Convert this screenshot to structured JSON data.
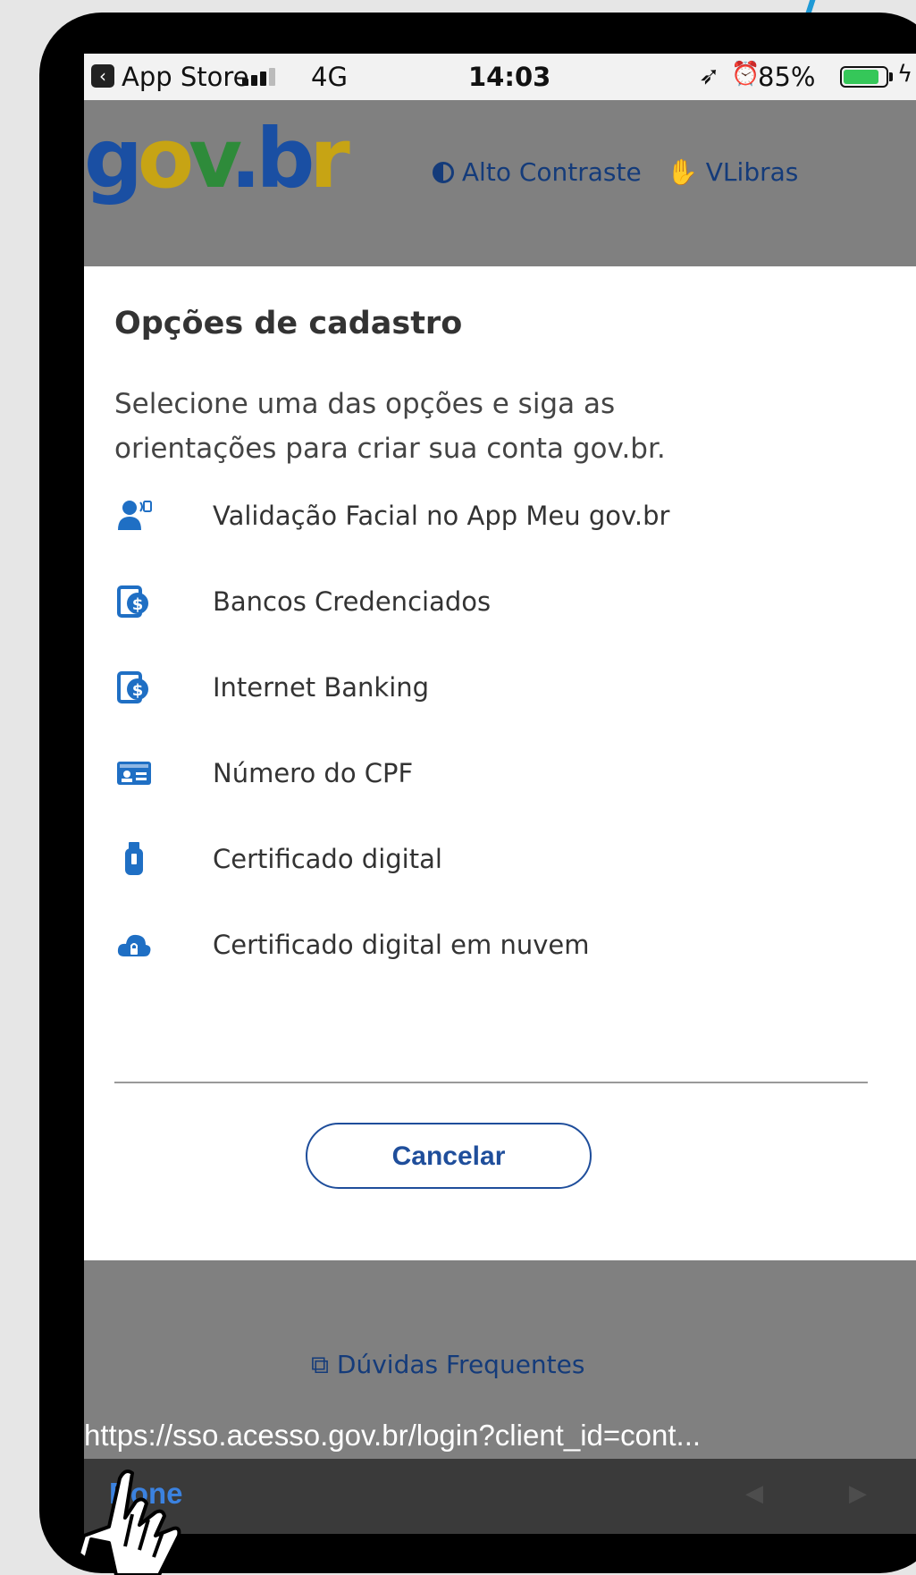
{
  "status_bar": {
    "back_icon": "back-arrow-icon",
    "app": "App Store",
    "network": "4G",
    "time": "14:03",
    "battery_percent": "85%",
    "battery_level": 0.85
  },
  "header": {
    "logo": "gov.br",
    "contrast_label": "Alto Contraste",
    "libras_label": "VLibras"
  },
  "main": {
    "title": "Opções de cadastro",
    "description": "Selecione uma das opções e siga as orientações para criar sua conta gov.br.",
    "options": [
      {
        "label": "Validação Facial no App Meu gov.br",
        "icon": "facial-validation-icon"
      },
      {
        "label": "Bancos Credenciados",
        "icon": "bank-icon"
      },
      {
        "label": "Internet Banking",
        "icon": "bank-icon"
      },
      {
        "label": "Número do CPF",
        "icon": "id-card-icon"
      },
      {
        "label": "Certificado digital",
        "icon": "usb-token-icon"
      },
      {
        "label": "Certificado digital em nuvem",
        "icon": "cloud-icon"
      }
    ],
    "cancel_label": "Cancelar"
  },
  "footer": {
    "faq_label": "Dúvidas Frequentes"
  },
  "browser": {
    "url": "https://sso.acesso.gov.br/login?client_id=cont...",
    "done_label": "Done"
  },
  "colors": {
    "accent": "#1f4e9b",
    "header_bg": "#808080",
    "toolbar_bg": "#3a3a3a"
  }
}
